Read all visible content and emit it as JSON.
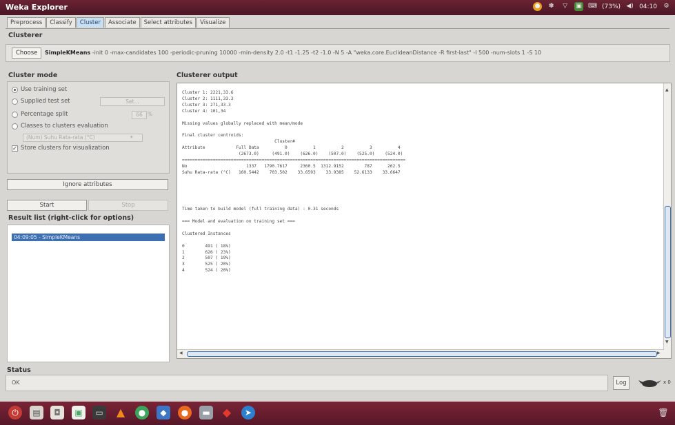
{
  "window": {
    "title": "Weka Explorer"
  },
  "tray": {
    "battery": "(73%)",
    "clock": "04:10"
  },
  "tabs": [
    "Preprocess",
    "Classify",
    "Cluster",
    "Associate",
    "Select attributes",
    "Visualize"
  ],
  "active_tab": "Cluster",
  "clusterer": {
    "section_label": "Clusterer",
    "choose_label": "Choose",
    "algorithm_name": "SimpleKMeans",
    "algorithm_options": "-init 0 -max-candidates 100 -periodic-pruning 10000 -min-density 2.0 -t1 -1.25 -t2 -1.0 -N 5 -A \"weka.core.EuclideanDistance -R first-last\" -I 500 -num-slots 1 -S 10"
  },
  "cluster_mode": {
    "label": "Cluster mode",
    "use_training": "Use training set",
    "supplied_test": "Supplied test set",
    "set_button": "Set...",
    "percentage_split": "Percentage split",
    "percent_value": "66",
    "classes_to_clusters": "Classes to clusters evaluation",
    "class_select": "(Num) Suhu Rata-rata (°C)",
    "store_clusters": "Store clusters for visualization"
  },
  "ignore_button": "Ignore attributes",
  "start_button": "Start",
  "stop_button": "Stop",
  "result_list": {
    "label": "Result list (right-click for options)",
    "items": [
      "04:09:05 - SimpleKMeans"
    ]
  },
  "output": {
    "label": "Clusterer output",
    "text": "Cluster 1: 2221,33.6\nCluster 2: 1111,33.3\nCluster 3: 271,33.3\nCluster 4: 101,34\n\nMissing values globally replaced with mean/mode\n\nFinal cluster centroids:\n                                    Cluster#\nAttribute            Full Data          0          1          2          3          4\n                      (2673.0)     (491.0)    (626.0)    (507.0)    (525.0)    (524.0)\n=======================================================================================\nNo                       1337   1790.7617     2360.5  1312.9152        787      262.5\nSuhu Rata-rata (°C)   160.5442    703.502    33.6593    33.9385    52.6133    33.6647\n\n\n\n\n\nTime taken to build model (full training data) : 0.31 seconds\n\n=== Model and evaluation on training set ===\n\nClustered Instances\n\n0        491 ( 18%)\n1        626 ( 23%)\n2        507 ( 19%)\n3        525 ( 20%)\n4        524 ( 20%)"
  },
  "status": {
    "label": "Status",
    "text": "OK",
    "log_button": "Log",
    "extra": "x 0"
  },
  "colors": {
    "titlebar": "#5a1c2c",
    "selected": "#3d6fb3",
    "taskbar": "#6a1f30"
  },
  "taskbar_icons": [
    "power-icon",
    "files-icon",
    "bag-icon",
    "document-icon",
    "terminal-icon",
    "vlc-icon",
    "chrome-icon",
    "weka-icon",
    "firefox-icon",
    "folder-icon",
    "ruby-icon",
    "telegram-icon",
    "trash-icon"
  ]
}
